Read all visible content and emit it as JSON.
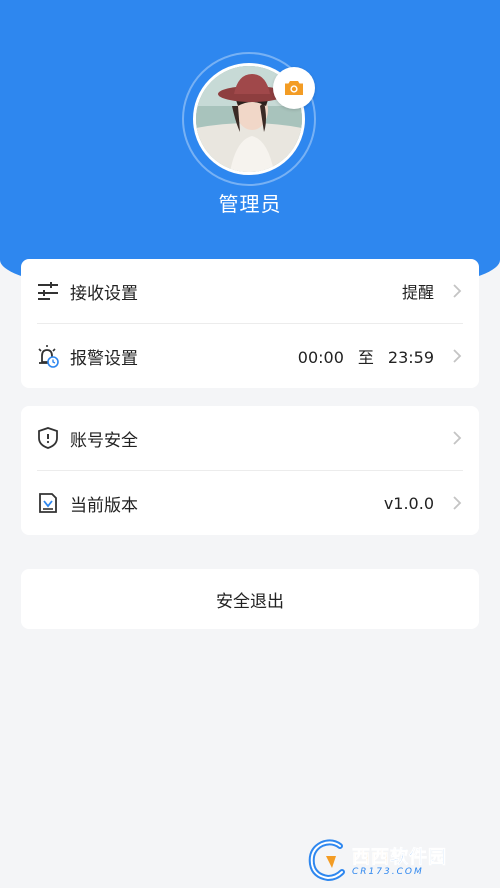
{
  "profile": {
    "username": "管理员",
    "avatar_icon": "user-photo",
    "camera_icon": "camera-icon"
  },
  "settings_group": {
    "receive": {
      "label": "接收设置",
      "value": "提醒",
      "icon": "sliders-icon"
    },
    "alarm": {
      "label": "报警设置",
      "start": "00:00",
      "separator": "至",
      "end": "23:59",
      "icon": "alarm-clock-icon"
    }
  },
  "info_group": {
    "account": {
      "label": "账号安全",
      "icon": "shield-icon"
    },
    "version": {
      "label": "当前版本",
      "value": "v1.0.0",
      "icon": "download-icon"
    }
  },
  "logout": {
    "label": "安全退出"
  },
  "watermark": {
    "main_orange": "西西",
    "main_blue": "软件园",
    "sub": "CR173.COM"
  },
  "colors": {
    "primary": "#2e87ef",
    "accent": "#f39c24",
    "background": "#f4f5f7"
  }
}
